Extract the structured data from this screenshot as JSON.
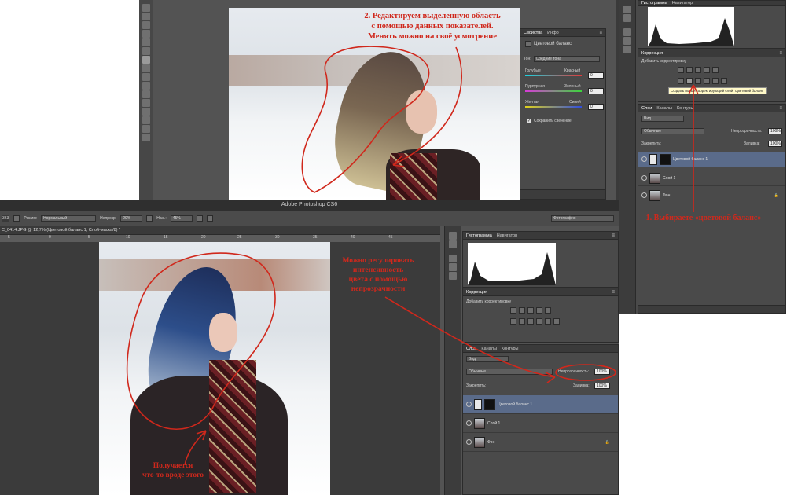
{
  "top": {
    "annotation": "2. Редактируем выделенную область\nс помощью данных показателей.\nМенять можно на своё усмотрение",
    "properties": {
      "tabs": [
        "Свойства",
        "Инфо"
      ],
      "title": "Цветовой баланс",
      "tone_label": "Тон:",
      "tone_value": "Средние тона",
      "sliders": [
        {
          "left": "Голубые",
          "right": "Красный",
          "value": "0"
        },
        {
          "left": "Пурпурная",
          "right": "Зеленый",
          "value": "0"
        },
        {
          "left": "Желтая",
          "right": "Синий",
          "value": "0"
        }
      ],
      "preserve": "Сохранить свечение"
    }
  },
  "right": {
    "histogram_tab": "Гистограмма",
    "navigator_tab": "Навигатор",
    "correction_tab": "Коррекция",
    "add_adjustment": "Добавить корректировку",
    "tooltip": "Создать новый корректирующий слой \"Цветовой баланс\"",
    "layers_tabs": [
      "Слои",
      "Каналы",
      "Контуры"
    ],
    "kind": "Вид",
    "blend": "Обычные",
    "opacity_label": "Непрозрачность:",
    "opacity_value": "100%",
    "lock_label": "Закрепить:",
    "fill_label": "Заливка:",
    "fill_value": "100%",
    "layers": [
      "Цветовой баланс 1",
      "Слой 1",
      "Фон"
    ],
    "annotation": "1. Выбираете «цветовой баланс»"
  },
  "bottom": {
    "app_title": "Adobe Photoshop CS6",
    "options": {
      "brush_size": "363",
      "mode_label": "Режим:",
      "mode_value": "Нормальный",
      "opacity_label": "Непрозр:",
      "opacity_value": "29%",
      "flow_label": "Наж.:",
      "flow_value": "45%",
      "workspace": "Фотография"
    },
    "doc_tab": "C_0414.JPG @ 12,7% (Цветовой баланс 1, Слой-маска/8) *",
    "ruler_marks": [
      "5",
      "0",
      "5",
      "10",
      "15",
      "20",
      "25",
      "30",
      "35",
      "40",
      "45"
    ],
    "annotation_opacity": "Можно регулировать\nинтенсивность\nцвета с помощью\nнепрозрачности",
    "annotation_result": "Получается\nчто-то вроде этого",
    "histogram_tab": "Гистограмма",
    "navigator_tab": "Навигатор",
    "correction_tab": "Коррекция",
    "add_adjustment": "Добавить корректировку",
    "layers_tabs": [
      "Слои",
      "Каналы",
      "Контуры"
    ],
    "kind": "Вид",
    "blend": "Обычные",
    "opacity_label": "Непрозрачность:",
    "opacity_value": "100%",
    "lock_label": "Закрепить:",
    "fill_label": "Заливка:",
    "fill_value": "100%",
    "layers": [
      "Цветовой баланс 1",
      "Слой 1",
      "Фон"
    ]
  },
  "colors": {
    "ps_bg": "#535353",
    "panel_bg": "#4a4a4a",
    "annotation_red": "#d0281c",
    "selected_layer": "#5a6b8a"
  }
}
